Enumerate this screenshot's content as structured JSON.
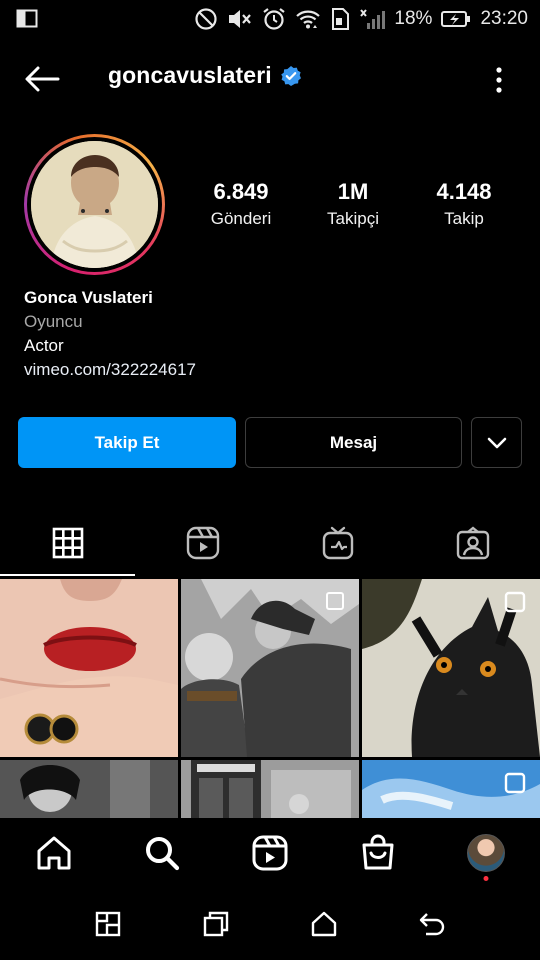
{
  "status_bar": {
    "battery_percent": "18%",
    "time": "23:20",
    "icons": [
      "screen-mirror-icon",
      "do-not-disturb-icon",
      "mute-icon",
      "alarm-icon",
      "wifi-icon",
      "sim-icon",
      "signal-icon",
      "battery-charging-icon"
    ]
  },
  "header": {
    "username": "goncavuslateri",
    "verified": true,
    "accent_color": "#3897f0"
  },
  "stats": {
    "posts": {
      "value": "6.849",
      "label": "Gönderi"
    },
    "followers": {
      "value": "1M",
      "label": "Takipçi"
    },
    "following": {
      "value": "4.148",
      "label": "Takip"
    }
  },
  "bio": {
    "name": "Gonca Vuslateri",
    "category": "Oyuncu",
    "text": "Actor",
    "link": "vimeo.com/322224617"
  },
  "actions": {
    "follow_label": "Takip Et",
    "message_label": "Mesaj",
    "follow_color": "#0095f6"
  },
  "tabs": [
    {
      "icon": "grid-icon",
      "active": true
    },
    {
      "icon": "reels-icon",
      "active": false
    },
    {
      "icon": "igtv-icon",
      "active": false
    },
    {
      "icon": "tagged-icon",
      "active": false
    }
  ],
  "bottom_nav": [
    "home-icon",
    "search-icon",
    "reels-icon",
    "shop-icon",
    "profile-avatar"
  ],
  "system_nav": [
    "recent-apps-icon",
    "overview-icon",
    "home-icon",
    "back-icon"
  ]
}
